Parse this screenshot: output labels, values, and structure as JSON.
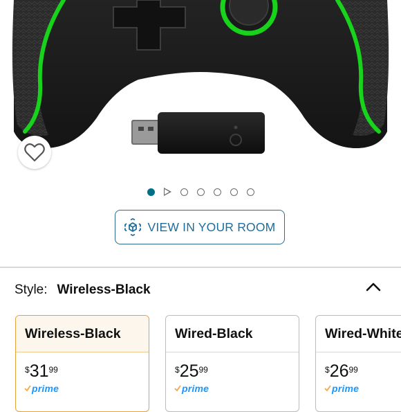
{
  "image_carousel": {
    "active_index": 0,
    "total": 7
  },
  "view_in_room": {
    "label": "VIEW IN YOUR ROOM"
  },
  "style_selector": {
    "label": "Style:",
    "selected": "Wireless-Black",
    "options": [
      {
        "name": "Wireless-Black",
        "currency": "$",
        "whole": "31",
        "fraction": "99",
        "prime": "prime",
        "selected": true
      },
      {
        "name": "Wired-Black",
        "currency": "$",
        "whole": "25",
        "fraction": "99",
        "prime": "prime",
        "selected": false
      },
      {
        "name": "Wired-White",
        "currency": "$",
        "whole": "26",
        "fraction": "99",
        "prime": "prime",
        "selected": false
      }
    ]
  },
  "colors": {
    "accent_link": "#1f6d9a",
    "carousel_active": "#007185",
    "selected_border": "#e7a13b",
    "prime_blue": "#1a98ff",
    "controller_green": "#18d21c"
  }
}
